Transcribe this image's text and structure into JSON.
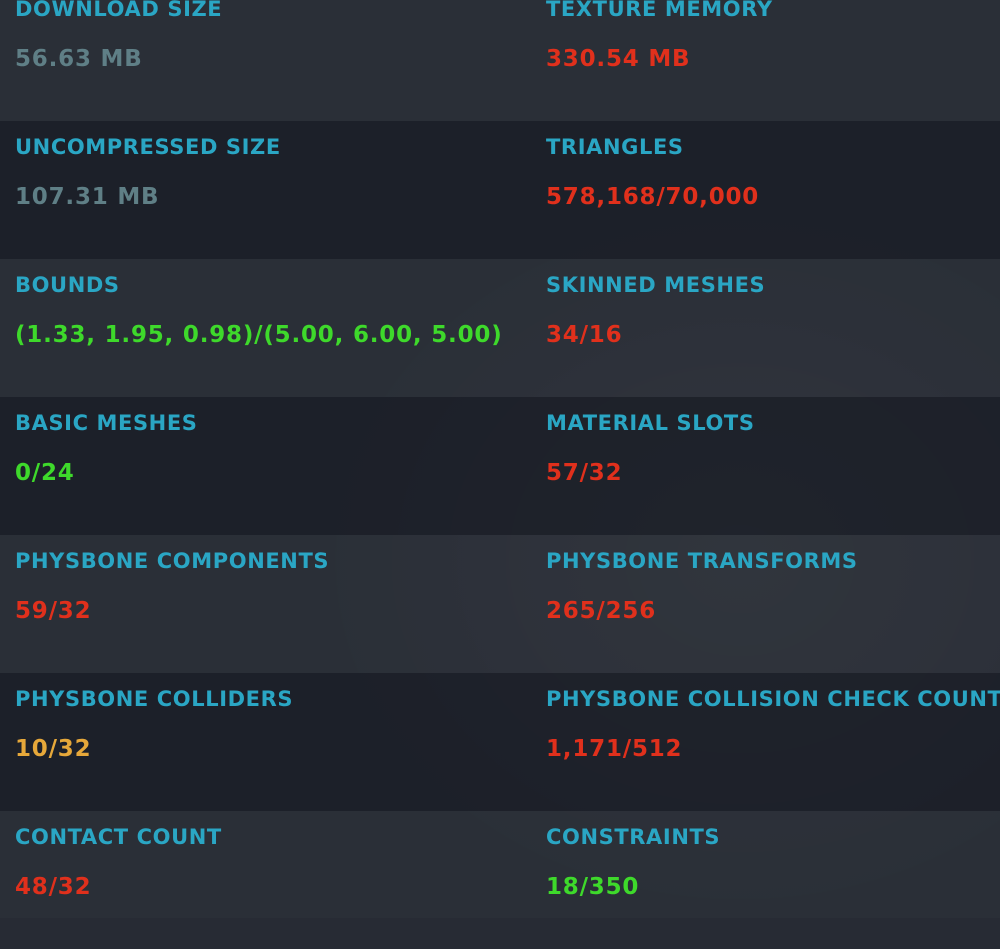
{
  "colors": {
    "label": "#2aa6c4",
    "neutral": "#5f7f86",
    "good": "#3ed92b",
    "medium": "#e6a83a",
    "bad": "#e0301c"
  },
  "stats": [
    {
      "label": "DOWNLOAD SIZE",
      "value": "56.63 MB",
      "status": "neutral"
    },
    {
      "label": "TEXTURE MEMORY",
      "value": "330.54 MB",
      "status": "bad"
    },
    {
      "label": "UNCOMPRESSED SIZE",
      "value": "107.31 MB",
      "status": "neutral"
    },
    {
      "label": "TRIANGLES",
      "value": "578,168/70,000",
      "status": "bad"
    },
    {
      "label": "BOUNDS",
      "value": "(1.33, 1.95, 0.98)/(5.00, 6.00, 5.00)",
      "status": "good"
    },
    {
      "label": "SKINNED MESHES",
      "value": "34/16",
      "status": "bad"
    },
    {
      "label": "BASIC MESHES",
      "value": "0/24",
      "status": "good"
    },
    {
      "label": "MATERIAL SLOTS",
      "value": "57/32",
      "status": "bad"
    },
    {
      "label": "PHYSBONE COMPONENTS",
      "value": "59/32",
      "status": "bad"
    },
    {
      "label": "PHYSBONE TRANSFORMS",
      "value": "265/256",
      "status": "bad"
    },
    {
      "label": "PHYSBONE COLLIDERS",
      "value": "10/32",
      "status": "medium"
    },
    {
      "label": "PHYSBONE COLLISION CHECK COUNT",
      "value": "1,171/512",
      "status": "bad"
    },
    {
      "label": "CONTACT COUNT",
      "value": "48/32",
      "status": "bad"
    },
    {
      "label": "CONSTRAINTS",
      "value": "18/350",
      "status": "good"
    }
  ]
}
